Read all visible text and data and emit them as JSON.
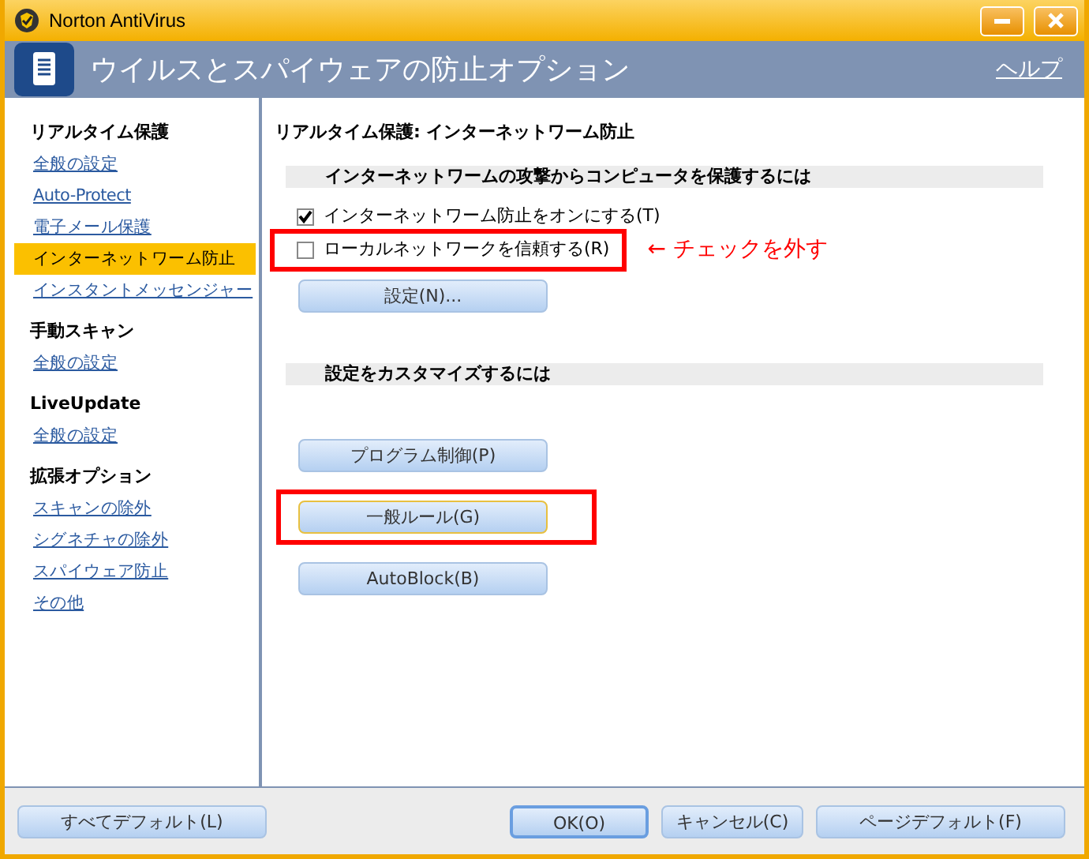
{
  "window": {
    "title": "Norton AntiVirus"
  },
  "header": {
    "title": "ウイルスとスパイウェアの防止オプション",
    "help": "ヘルプ"
  },
  "sidebar": {
    "groups": [
      {
        "title": "リアルタイム保護",
        "items": [
          {
            "label": "全般の設定",
            "selected": false
          },
          {
            "label": "Auto-Protect",
            "selected": false
          },
          {
            "label": "電子メール保護",
            "selected": false
          },
          {
            "label": "インターネットワーム防止",
            "selected": true
          },
          {
            "label": "インスタントメッセンジャー",
            "selected": false
          }
        ]
      },
      {
        "title": "手動スキャン",
        "items": [
          {
            "label": "全般の設定",
            "selected": false
          }
        ]
      },
      {
        "title": "LiveUpdate",
        "items": [
          {
            "label": "全般の設定",
            "selected": false
          }
        ]
      },
      {
        "title": "拡張オプション",
        "items": [
          {
            "label": "スキャンの除外",
            "selected": false
          },
          {
            "label": "シグネチャの除外",
            "selected": false
          },
          {
            "label": "スパイウェア防止",
            "selected": false
          },
          {
            "label": "その他",
            "selected": false
          }
        ]
      }
    ]
  },
  "content": {
    "title": "リアルタイム保護: インターネットワーム防止",
    "sections": [
      {
        "heading": "インターネットワームの攻撃からコンピュータを保護するには",
        "items": [
          {
            "kind": "checkbox",
            "label": "インターネットワーム防止をオンにする(T)",
            "checked": true,
            "highlighted": false
          },
          {
            "kind": "checkbox",
            "label": "ローカルネットワークを信頼する(R)",
            "checked": false,
            "highlighted": true,
            "note": "← チェックを外す"
          },
          {
            "kind": "button",
            "label": "設定(N)...",
            "highlighted": false
          }
        ]
      },
      {
        "heading": "設定をカスタマイズするには",
        "items": [
          {
            "kind": "button",
            "label": "プログラム制御(P)",
            "highlighted": false
          },
          {
            "kind": "button",
            "label": "一般ルール(G)",
            "highlighted": true,
            "focused": true
          },
          {
            "kind": "button",
            "label": "AutoBlock(B)",
            "highlighted": false
          }
        ]
      }
    ]
  },
  "footer": {
    "left": [
      {
        "label": "すべてデフォルト(L)",
        "default": false
      }
    ],
    "right": [
      {
        "label": "OK(O)",
        "default": true
      },
      {
        "label": "キャンセル(C)",
        "default": false
      },
      {
        "label": "ページデフォルト(F)",
        "default": false
      }
    ]
  }
}
